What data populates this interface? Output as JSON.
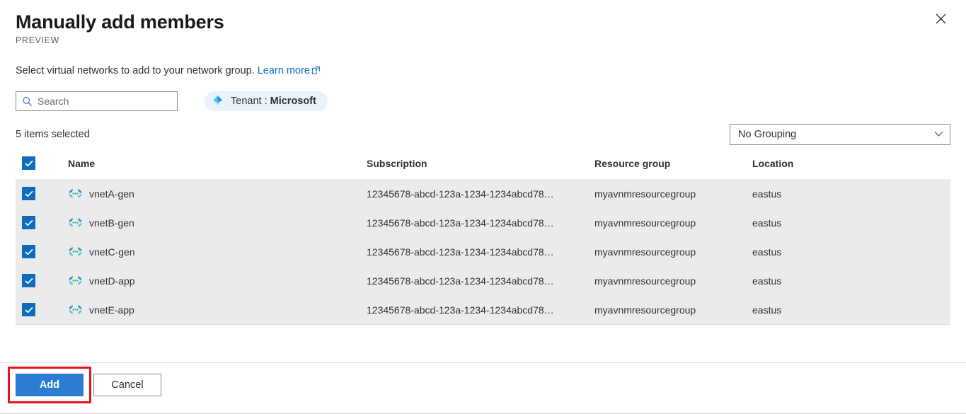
{
  "header": {
    "title": "Manually add members",
    "preview_label": "PREVIEW",
    "close_icon": "close-icon"
  },
  "description": {
    "text": "Select virtual networks to add to your network group.",
    "link_label": "Learn more",
    "link_icon": "external-link-icon"
  },
  "toolbar": {
    "search_placeholder": "Search",
    "search_value": "",
    "search_icon": "search-icon",
    "tenant_icon": "tenant-diamond-icon",
    "tenant_prefix": "Tenant :",
    "tenant_name": "Microsoft"
  },
  "subbar": {
    "items_selected": "5 items selected",
    "grouping_value": "No Grouping",
    "grouping_icon": "chevron-down-icon"
  },
  "table": {
    "columns": [
      "Name",
      "Subscription",
      "Resource group",
      "Location"
    ],
    "select_all_checked": true,
    "rows": [
      {
        "checked": true,
        "icon": "virtual-network-icon",
        "name": "vnetA-gen",
        "subscription": "12345678-abcd-123a-1234-1234abcd78…",
        "resource_group": "myavnmresourcegroup",
        "location": "eastus"
      },
      {
        "checked": true,
        "icon": "virtual-network-icon",
        "name": "vnetB-gen",
        "subscription": "12345678-abcd-123a-1234-1234abcd78…",
        "resource_group": "myavnmresourcegroup",
        "location": "eastus"
      },
      {
        "checked": true,
        "icon": "virtual-network-icon",
        "name": "vnetC-gen",
        "subscription": "12345678-abcd-123a-1234-1234abcd78…",
        "resource_group": "myavnmresourcegroup",
        "location": "eastus"
      },
      {
        "checked": true,
        "icon": "virtual-network-icon",
        "name": "vnetD-app",
        "subscription": "12345678-abcd-123a-1234-1234abcd78…",
        "resource_group": "myavnmresourcegroup",
        "location": "eastus"
      },
      {
        "checked": true,
        "icon": "virtual-network-icon",
        "name": "vnetE-app",
        "subscription": "12345678-abcd-123a-1234-1234abcd78…",
        "resource_group": "myavnmresourcegroup",
        "location": "eastus"
      }
    ]
  },
  "footer": {
    "primary_label": "Add",
    "secondary_label": "Cancel"
  },
  "colors": {
    "accent": "#0f6cbd",
    "primary_button": "#2b7cd3",
    "annotation": "#e81123",
    "row_background": "#ebebeb",
    "tenant_pill": "#e8f3fc"
  }
}
